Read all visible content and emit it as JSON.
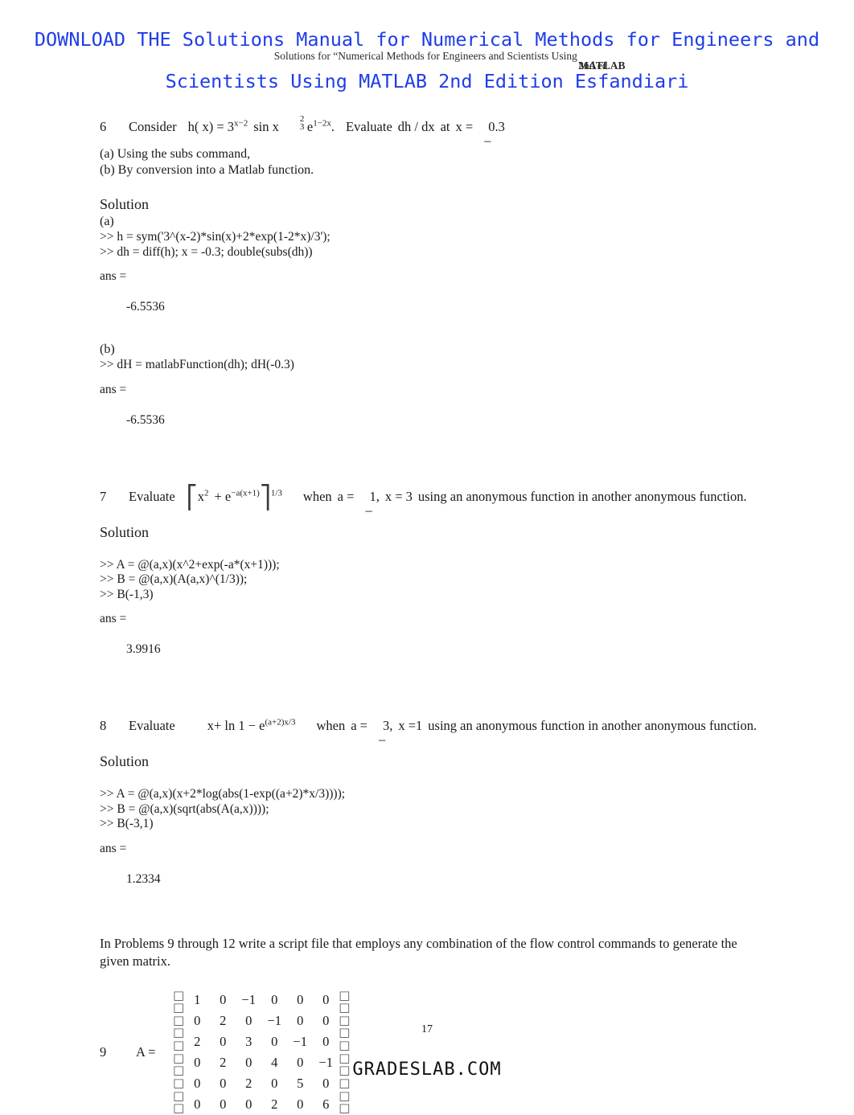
{
  "promo": {
    "line1": "DOWNLOAD THE Solutions Manual for Numerical Methods for Engineers and",
    "line2": "Scientists Using MATLAB 2nd Edition Esfandiari",
    "color": "#1f3de8"
  },
  "running_head": {
    "text": "Solutions for “Numerical Methods for Engineers and Scientists Using ",
    "overlap_bold": "MATLAB",
    "overlap_plain": "2nd ed"
  },
  "problems": [
    {
      "number": "6",
      "verb": "Consider",
      "statement_parts": {
        "hx": "h( x) = 3",
        "exp1": "x−2",
        "sinx": "sin x",
        "frac_num": "2",
        "frac_den": "3",
        "e": "e",
        "exp2": "1−2x",
        "period": ".",
        "evaluate": "Evaluate",
        "derivative": "dh / dx",
        "at": "at",
        "xeq": "x =",
        "minus": "–",
        "value": "0.3"
      },
      "subparts": [
        "(a)  Using  the subs    command,",
        "(b) By conversion into a Matlab function."
      ],
      "solution_label": "Solution",
      "blocks": [
        {
          "part": "(a)",
          "code": [
            ">> h = sym('3^(x-2)*sin(x)+2*exp(1-2*x)/3');",
            ">> dh = diff(h); x = -0.3; double(subs(dh))"
          ],
          "ans_label": "ans =",
          "ans_value": "-6.5536"
        },
        {
          "part": "(b)",
          "code": [
            ">> dH = matlabFunction(dh); dH(-0.3)"
          ],
          "ans_label": "ans =",
          "ans_value": "-6.5536"
        }
      ]
    },
    {
      "number": "7",
      "verb": "Evaluate",
      "expression": {
        "open_bracket": "⎡",
        "x": "x",
        "x_exp": "2",
        "plus": "+ e",
        "e_exp": "−a(x+1)",
        "close_bracket": "⎤",
        "outer_exp": "1/3"
      },
      "condition": {
        "when": "when",
        "aeq": "a =",
        "aminus": "–",
        "aval": "1",
        "comma": ",",
        "xeq": "x = 3"
      },
      "tail": "using an anonymous function in another anonymous function.",
      "solution_label": "Solution",
      "code": [
        ">> A = @(a,x)(x^2+exp(-a*(x+1)));",
        ">> B = @(a,x)(A(a,x)^(1/3));",
        ">> B(-1,3)"
      ],
      "ans_label": "ans =",
      "ans_value": "3.9916"
    },
    {
      "number": "8",
      "verb": "Evaluate",
      "expression": {
        "body": "x+ ln 1 − e",
        "e_exp": "(a+2)x/3"
      },
      "condition": {
        "when": "when",
        "aeq": "a =",
        "aminus": "–",
        "aval": "3",
        "comma": ",",
        "xeq": "x =1"
      },
      "tail": "using an anonymous function in another anonymous function.",
      "solution_label": "Solution",
      "code": [
        ">> A = @(a,x)(x+2*log(abs(1-exp((a+2)*x/3))));",
        ">> B = @(a,x)(sqrt(abs(A(a,x))));",
        ">> B(-3,1)"
      ],
      "ans_label": "ans =",
      "ans_value": "1.2334"
    }
  ],
  "instruction": {
    "line1": "In Problems 9 through 12 write a script file that employs any combination of the flow control commands to generate the",
    "line2": "given matrix."
  },
  "matrix_problem": {
    "number": "9",
    "label": "A =",
    "rows": [
      [
        "1",
        "0",
        "−1",
        "0",
        "0",
        "0"
      ],
      [
        "0",
        "2",
        "0",
        "−1",
        "0",
        "0"
      ],
      [
        "2",
        "0",
        "3",
        "0",
        "−1",
        "0"
      ],
      [
        "0",
        "2",
        "0",
        "4",
        "0",
        "−1"
      ],
      [
        "0",
        "0",
        "2",
        "0",
        "5",
        "0"
      ],
      [
        "0",
        "0",
        "0",
        "2",
        "0",
        "6"
      ]
    ]
  },
  "footer": {
    "page_number": "17",
    "brand": "GRADESLAB.COM"
  }
}
